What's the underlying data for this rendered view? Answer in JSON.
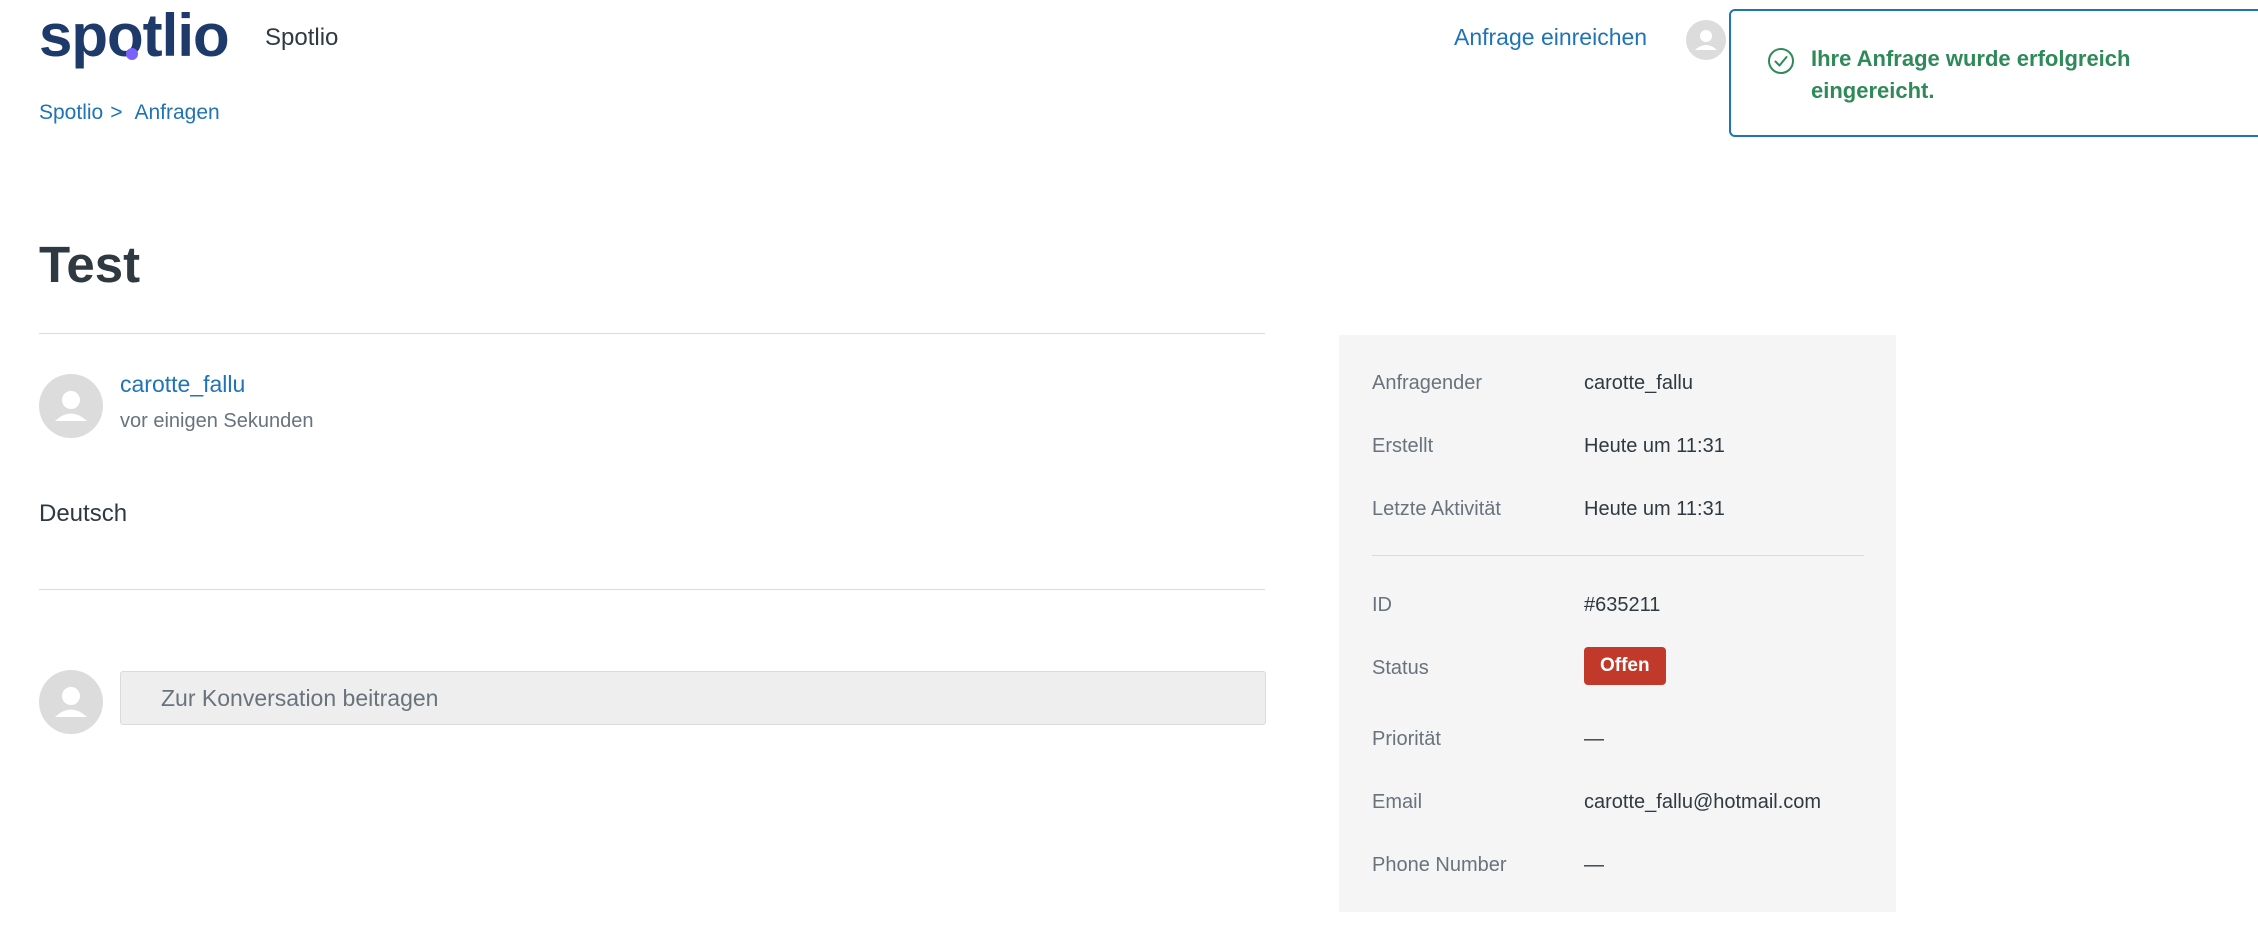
{
  "header": {
    "logo_text": "spotlio",
    "brand_name": "Spotlio",
    "submit_request_label": "Anfrage einreichen"
  },
  "toast": {
    "message": "Ihre Anfrage wurde erfolgreich eingereicht.",
    "icon": "check-circle-icon",
    "color": "#2f8a5a"
  },
  "breadcrumbs": {
    "items": [
      "Spotlio",
      "Anfragen"
    ],
    "separator": ">"
  },
  "request": {
    "title": "Test"
  },
  "comment": {
    "author": "carotte_fallu",
    "time": "vor einigen Sekunden",
    "body": "Deutsch"
  },
  "reply": {
    "placeholder": "Zur Konversation beitragen"
  },
  "details": {
    "requester": {
      "label": "Anfragender",
      "value": "carotte_fallu"
    },
    "created": {
      "label": "Erstellt",
      "value": "Heute um 11:31"
    },
    "last_activity": {
      "label": "Letzte Aktivität",
      "value": "Heute um 11:31"
    },
    "id": {
      "label": "ID",
      "value": "#635211"
    },
    "status": {
      "label": "Status",
      "value": "Offen",
      "color": "#c0392b"
    },
    "priority": {
      "label": "Priorität",
      "value": "—"
    },
    "email": {
      "label": "Email",
      "value": "carotte_fallu@hotmail.com"
    },
    "phone": {
      "label": "Phone Number",
      "value": "—"
    }
  },
  "colors": {
    "link": "#1f73b7",
    "brand_navy": "#1e3a6b",
    "brand_accent": "#7b61ff"
  }
}
